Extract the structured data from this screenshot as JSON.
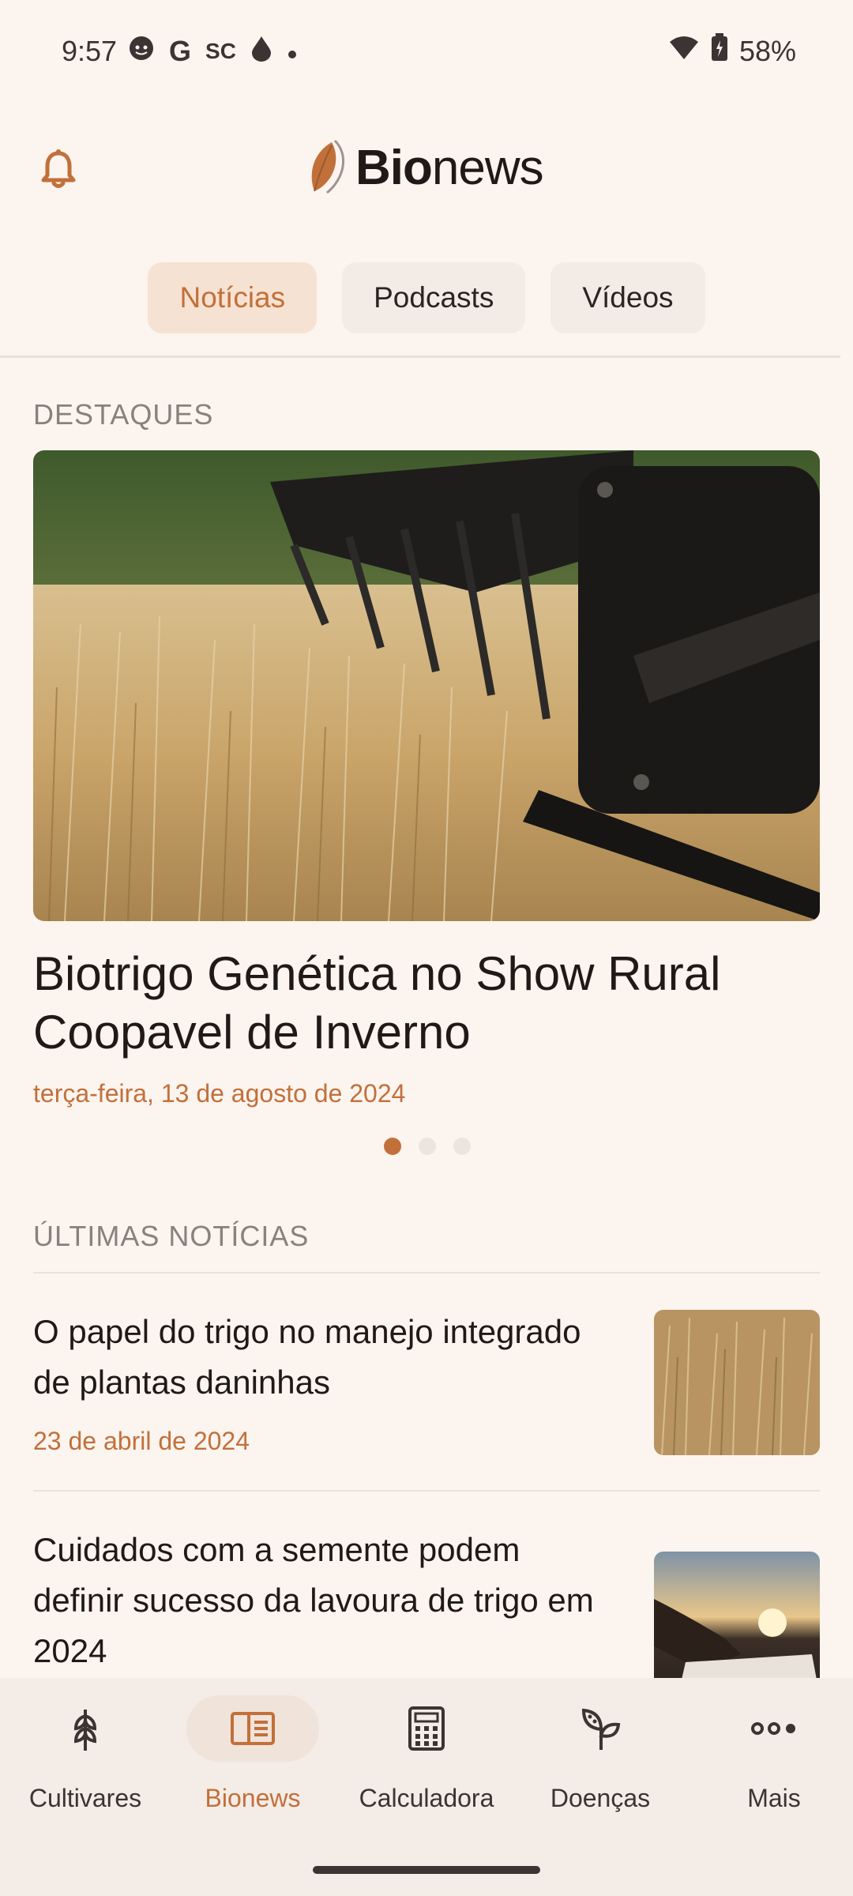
{
  "status_bar": {
    "time": "9:57",
    "left_icons": [
      "face-icon",
      "google-icon",
      "sc-icon",
      "drop-icon",
      "dot-icon"
    ],
    "battery": "58%"
  },
  "header": {
    "brand_bold": "Bio",
    "brand_light": "news"
  },
  "tabs": [
    {
      "label": "Notícias",
      "active": true
    },
    {
      "label": "Podcasts",
      "active": false
    },
    {
      "label": "Vídeos",
      "active": false
    }
  ],
  "highlights": {
    "label": "DESTAQUES",
    "title": "Biotrigo Genética no Show Rural Coopavel de Inverno",
    "date": "terça-feira, 13 de agosto de 2024",
    "pages": 3,
    "current_page": 1
  },
  "latest": {
    "label": "ÚLTIMAS NOTÍCIAS",
    "items": [
      {
        "title": "O papel do trigo no manejo integrado de plantas daninhas",
        "date": "23 de abril de 2024"
      },
      {
        "title": "Cuidados com a semente podem definir sucesso da lavoura de trigo em 2024",
        "date": ""
      }
    ]
  },
  "bottom_nav": [
    {
      "label": "Cultivares",
      "icon": "wheat-icon",
      "active": false
    },
    {
      "label": "Bionews",
      "icon": "news-icon",
      "active": true
    },
    {
      "label": "Calculadora",
      "icon": "calculator-icon",
      "active": false
    },
    {
      "label": "Doenças",
      "icon": "plant-disease-icon",
      "active": false
    },
    {
      "label": "Mais",
      "icon": "more-icon",
      "active": false
    }
  ],
  "colors": {
    "accent": "#c2703a",
    "background": "#fbf4ef"
  }
}
